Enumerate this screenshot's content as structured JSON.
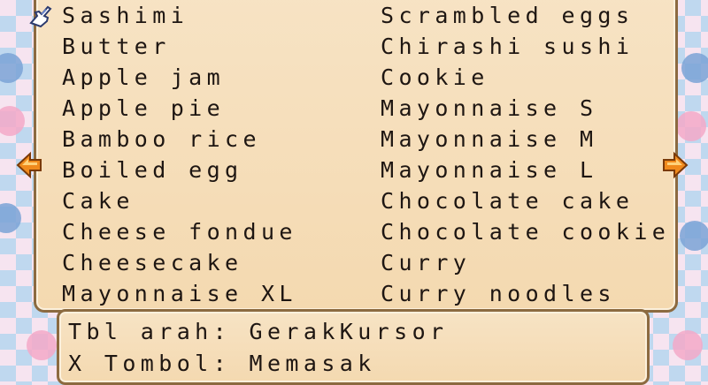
{
  "menu": {
    "left_column": [
      "Sashimi",
      "Butter",
      "Apple jam",
      "Apple pie",
      "Bamboo rice",
      "Boiled egg",
      "Cake",
      "Cheese fondue",
      "Cheesecake",
      "Mayonnaise XL"
    ],
    "right_column": [
      "Scrambled eggs",
      "Chirashi sushi",
      "Cookie",
      "Mayonnaise S",
      "Mayonnaise M",
      "Mayonnaise L",
      "Chocolate cake",
      "Chocolate cookie",
      "Curry",
      "Curry noodles"
    ],
    "selected": "Sashimi"
  },
  "help": {
    "line1": "Tbl arah: GerakKursor",
    "line2": "X Tombol: Memasak"
  },
  "colors": {
    "panel": "#f6dfb9",
    "border": "#8c6a40",
    "text": "#1e1612",
    "arrow": "#f08a1c"
  }
}
